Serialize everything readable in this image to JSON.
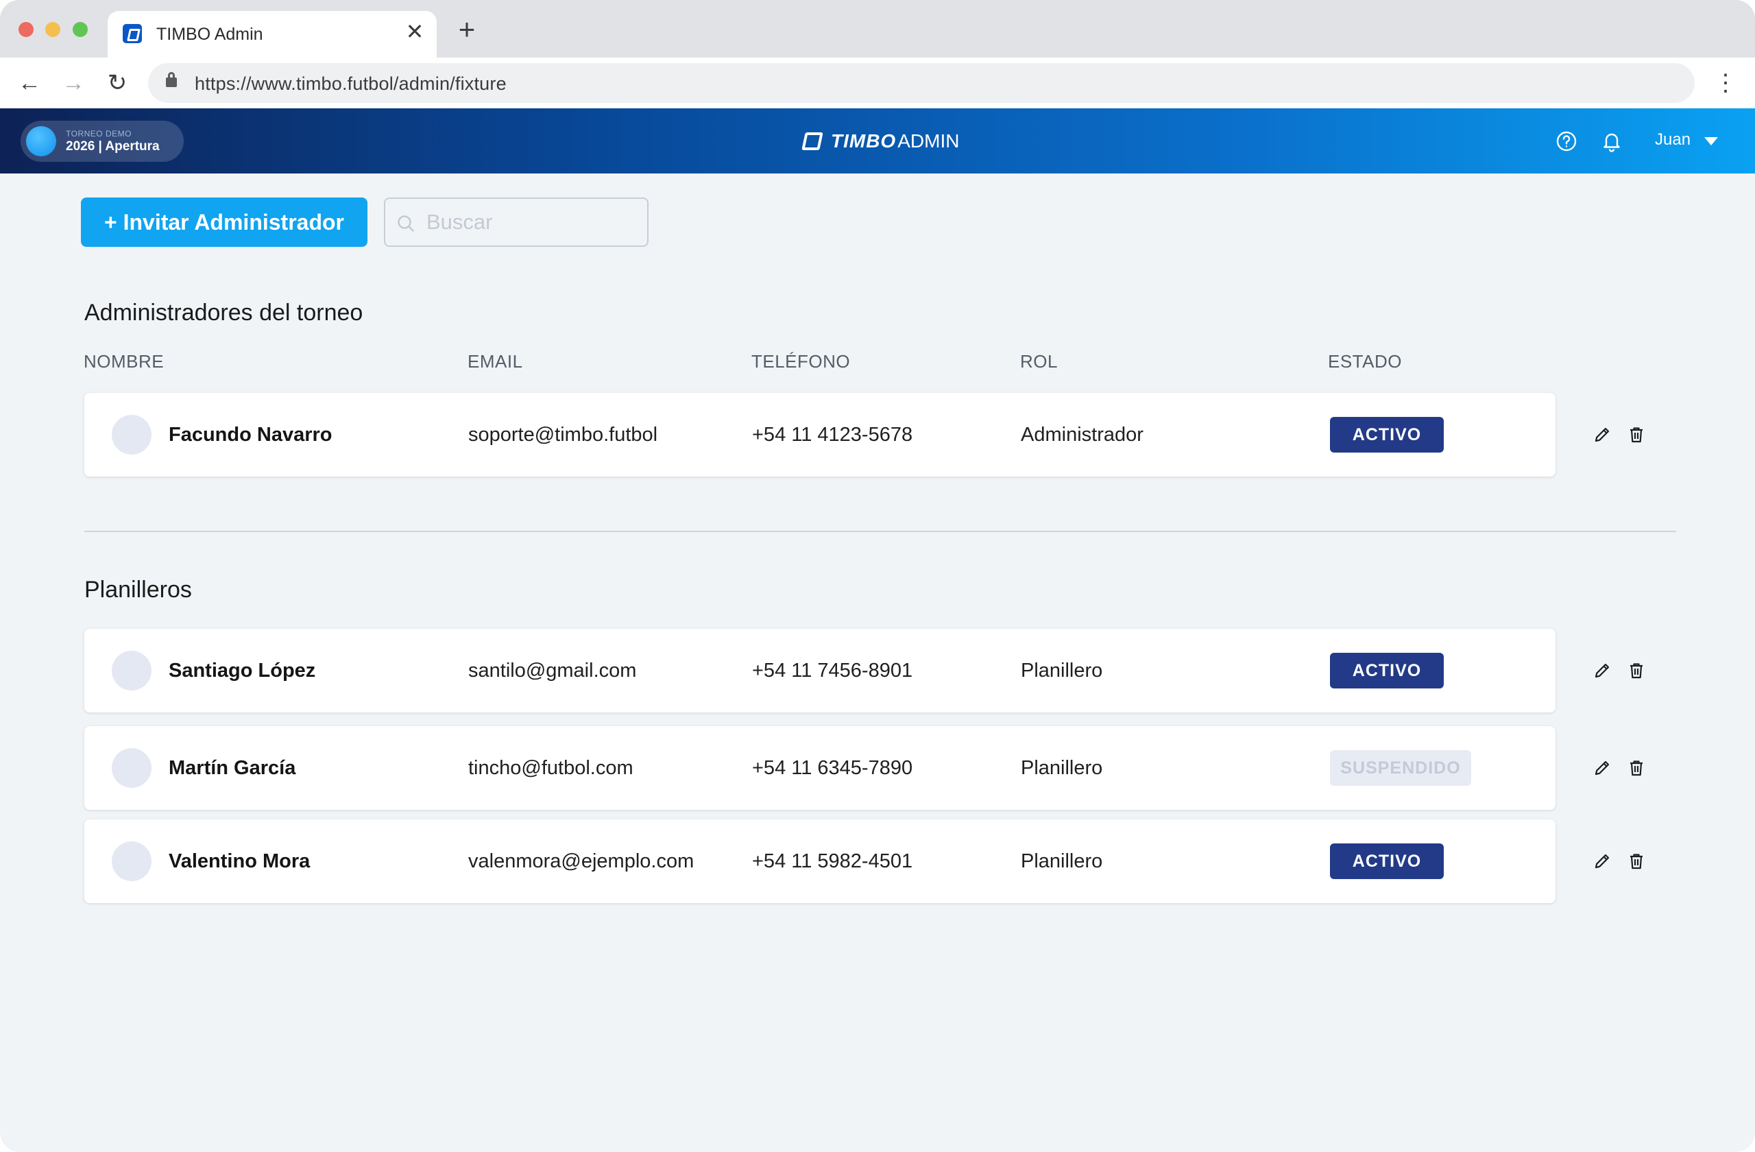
{
  "browser": {
    "tab_title": "TIMBO Admin",
    "tab_close": "✕",
    "new_tab": "+",
    "url": "https://www.timbo.futbol/admin/fixture",
    "back": "←",
    "forward": "→",
    "reload": "↻",
    "menu": "⋮"
  },
  "header": {
    "tournament_label": "TORNEO DEMO",
    "tournament_name": "2026 | Apertura",
    "brand_name": "TIMBO",
    "brand_suffix": "ADMIN",
    "user_name": "Juan",
    "gradient_colors": [
      "#0d2256",
      "#08499a",
      "#0a6fca",
      "#0aa1f2"
    ]
  },
  "toolbar": {
    "invite_label": "+ Invitar Administrador",
    "search_placeholder": "Buscar"
  },
  "columns": {
    "name": "NOMBRE",
    "email": "EMAIL",
    "phone": "TELÉFONO",
    "role": "ROL",
    "status": "ESTADO"
  },
  "admins": {
    "title": "Administradores del torneo",
    "rows": [
      {
        "name": "Facundo Navarro",
        "email": "soporte@timbo.futbol",
        "phone": "+54 11 4123-5678",
        "role": "Administrador",
        "status": "ACTIVO",
        "status_kind": "active"
      }
    ]
  },
  "planilleros": {
    "title": "Planilleros",
    "rows": [
      {
        "name": "Santiago López",
        "email": "santilo@gmail.com",
        "phone": "+54 11 7456-8901",
        "role": "Planillero",
        "status": "ACTIVO",
        "status_kind": "active"
      },
      {
        "name": "Martín García",
        "email": "tincho@futbol.com",
        "phone": "+54 11 6345-7890",
        "role": "Planillero",
        "status": "SUSPENDIDO",
        "status_kind": "suspended"
      },
      {
        "name": "Valentino Mora",
        "email": "valenmora@ejemplo.com",
        "phone": "+54 11 5982-4501",
        "role": "Planillero",
        "status": "ACTIVO",
        "status_kind": "active"
      }
    ]
  },
  "colors": {
    "accent": "#11a4f0",
    "badge_active": "#223a87",
    "badge_suspended_bg": "#e7ebf3",
    "badge_suspended_text": "#c3cad8",
    "page_bg": "#f1f4f7"
  },
  "icons": {
    "help": "help-circle-icon",
    "bell": "bell-icon",
    "edit": "pencil-icon",
    "delete": "trash-icon",
    "search": "search-icon",
    "lock": "lock-icon"
  }
}
